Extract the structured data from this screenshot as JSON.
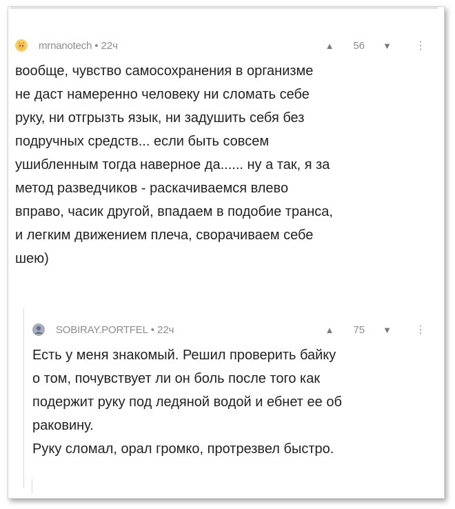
{
  "comments": [
    {
      "author": "mrnanotech",
      "time": "22ч",
      "score": "56",
      "avatar_icon": "cat-avatar-icon",
      "body": "вообще, чувство самосохранения в организме\nне даст намеренно человеку ни сломать себе\nруку, ни отгрызть язык, ни задушить себя без\nподручных средств... если быть совсем\nушибленным тогда наверное да...... ну а так, я за\nметод разведчиков - раскачиваемся влево\nвправо, часик другой, впадаем в подобие транса,\nи легким движением плеча, сворачиваем себе\nшею)"
    },
    {
      "author": "SOBIRAY.PORTFEL",
      "time": "22ч",
      "score": "75",
      "avatar_icon": "user-avatar-icon",
      "body": "Есть у меня знакомый. Решил проверить байку\nо том, почувствует ли он боль после того как\nподержит руку под ледяной водой и ебнет ее об\nраковину.\nРуку сломал, орал громко, протрезвел быстро."
    }
  ],
  "ui": {
    "separator": "•",
    "upvote_glyph": "▲",
    "downvote_glyph": "▼",
    "more_glyph": "⋮"
  }
}
